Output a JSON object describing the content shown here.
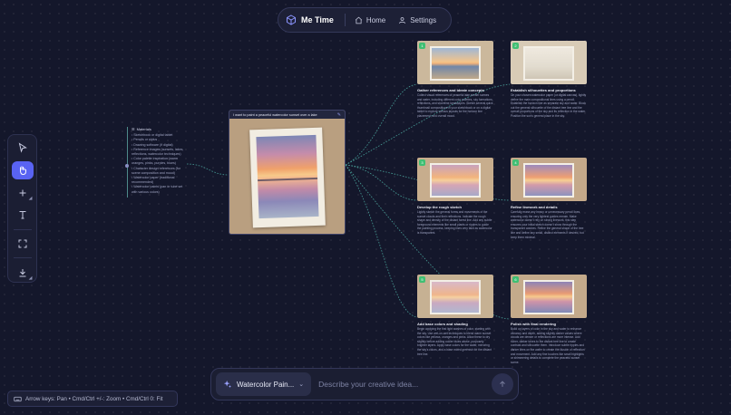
{
  "app": {
    "title": "Me Time"
  },
  "nav": {
    "home_label": "Home",
    "settings_label": "Settings"
  },
  "toolbar": {
    "tools": [
      {
        "name": "select",
        "icon": "cursor-icon"
      },
      {
        "name": "pan",
        "icon": "hand-icon",
        "active": true
      },
      {
        "name": "add",
        "icon": "plus-icon"
      },
      {
        "name": "text",
        "icon": "text-icon"
      },
      {
        "name": "fit",
        "icon": "fit-screen-icon"
      },
      {
        "name": "download",
        "icon": "download-icon"
      }
    ]
  },
  "notes": {
    "heading": "Materials",
    "items": [
      "Sketchbook or digital tablet",
      "Pencils or stylus",
      "Drawing software (if digital)",
      "Reference images (sunsets, lakes, reflections, watercolor techniques)",
      "Color palette inspiration (warm oranges, pinks, purples, blues)",
      "Character design references (for scene composition and mood)",
      "Watercolor paper (traditional recommended)",
      "Watercolor paints (pan or tube set with various colors)"
    ]
  },
  "main_card": {
    "prompt": "I want to paint a peaceful watercolor sunset over a lake"
  },
  "steps": [
    {
      "number": "1",
      "title": "Gather references and ideate concepts",
      "desc": "Collect visual references of peaceful lake sunset scenes and water, including different color palettes, sky formations, reflections, and shoreline landscapes. Sketch several quick thumbnail compositions in your sketchbook or on a digital tablet to explore various layouts for the horizon line placement, and overall mood."
    },
    {
      "number": "2",
      "title": "Establish silhouettes and proportions",
      "desc": "On your chosen watercolor paper (or digital canvas), lightly define the main compositional lines using a pencil. Establish the horizon line as separate sky and water. Block out the general silhouette of the distant tree line and the overall proportions of the sky and its reflection in the water. Position the sun's general place in the sky."
    },
    {
      "number": "3",
      "title": "Develop the rough sketch",
      "desc": "Lightly sketch the general forms and movements of the sunset clouds and their reflections. Indicate the rough shape and density of the distant forest line. Add any subtle foreground elements like small plants or ripples to guide the painting process, keeping lines very faint as watercolor is transparent."
    },
    {
      "number": "4",
      "title": "Refine linework and details",
      "desc": "Carefully erase any heavy or unnecessary pencil lines, ensuring only the very lightest guides remain. Make watercolor doesn't rely on strong linework, this step ensures your initial sketch doesn't show through the transparent washes. Refine the general shape of the tree line and define any small, distinct elements if desired, but keep them minimal."
    },
    {
      "number": "5",
      "title": "Add base colors and shading",
      "desc": "Begin applying the first light washes of color, starting with the sky. Use wet-on-wet techniques to blend warm sunset colors like yellows, oranges and pinks. Allow these to dry slightly before adding cooler blues above, purposely brighter layers. Apply base colors for the water, mirroring the sky's colors, and a base mixed greenish for the distant tree line."
    },
    {
      "number": "6",
      "title": "Polish with final rendering",
      "desc": "Build up layers of color in the sky and water to enhance vibrancy and depth, adding slightly darker values where clouds are denser or reflections are more intense. Add richer, darker tones to the distant tree line to create contrast and silhouette them. Introduce subtle ripples and darker lines on the water to create the illusion of reflection and movement. Add any fine touches like small highlights or shimmering details to complete the peaceful sunset scene."
    }
  ],
  "prompt_bar": {
    "style_label": "Watercolor Pain...",
    "placeholder": "Describe your creative idea..."
  },
  "hint": {
    "text": "Arrow keys: Pan • Cmd/Ctrl +/-: Zoom • Cmd/Ctrl 0: Fit"
  },
  "colors": {
    "background": "#14172b",
    "accent": "#5963f2",
    "link_line": "#4fb3a8",
    "step_badge": "#3fbf73"
  }
}
